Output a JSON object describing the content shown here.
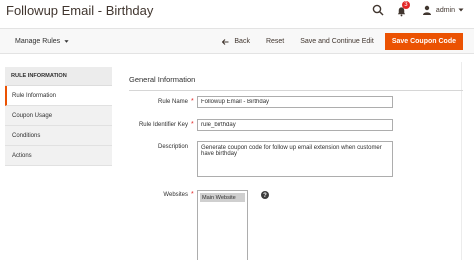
{
  "header": {
    "title": "Followup Email - Birthday",
    "notification_count": "3",
    "user_name": "admin"
  },
  "action_bar": {
    "manage_rules_label": "Manage Rules",
    "back_label": "Back",
    "reset_label": "Reset",
    "save_continue_label": "Save and Continue Edit",
    "save_coupon_label": "Save Coupon Code",
    "primary_color": "#eb5202"
  },
  "sidebar": {
    "heading": "RULE INFORMATION",
    "items": [
      {
        "label": "Rule Information"
      },
      {
        "label": "Coupon Usage"
      },
      {
        "label": "Conditions"
      },
      {
        "label": "Actions"
      }
    ]
  },
  "form": {
    "section_title": "General Information",
    "rule_name": {
      "label": "Rule Name",
      "value": "Followup Email - Birthday"
    },
    "rule_identifier": {
      "label": "Rule Identifier Key",
      "value": "rule_birthday"
    },
    "description": {
      "label": "Description",
      "value": "Generate coupon code for follow up email extension when customer have birthday"
    },
    "websites": {
      "label": "Websites",
      "options": [
        "Main Website"
      ]
    }
  }
}
